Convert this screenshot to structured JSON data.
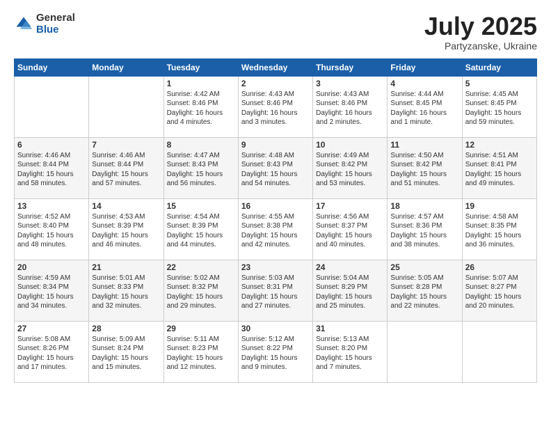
{
  "logo": {
    "general": "General",
    "blue": "Blue"
  },
  "title": "July 2025",
  "location": "Partyzanske, Ukraine",
  "weekdays": [
    "Sunday",
    "Monday",
    "Tuesday",
    "Wednesday",
    "Thursday",
    "Friday",
    "Saturday"
  ],
  "weeks": [
    [
      {
        "day": "",
        "info": ""
      },
      {
        "day": "",
        "info": ""
      },
      {
        "day": "1",
        "info": "Sunrise: 4:42 AM\nSunset: 8:46 PM\nDaylight: 16 hours\nand 4 minutes."
      },
      {
        "day": "2",
        "info": "Sunrise: 4:43 AM\nSunset: 8:46 PM\nDaylight: 16 hours\nand 3 minutes."
      },
      {
        "day": "3",
        "info": "Sunrise: 4:43 AM\nSunset: 8:46 PM\nDaylight: 16 hours\nand 2 minutes."
      },
      {
        "day": "4",
        "info": "Sunrise: 4:44 AM\nSunset: 8:45 PM\nDaylight: 16 hours\nand 1 minute."
      },
      {
        "day": "5",
        "info": "Sunrise: 4:45 AM\nSunset: 8:45 PM\nDaylight: 15 hours\nand 59 minutes."
      }
    ],
    [
      {
        "day": "6",
        "info": "Sunrise: 4:46 AM\nSunset: 8:44 PM\nDaylight: 15 hours\nand 58 minutes."
      },
      {
        "day": "7",
        "info": "Sunrise: 4:46 AM\nSunset: 8:44 PM\nDaylight: 15 hours\nand 57 minutes."
      },
      {
        "day": "8",
        "info": "Sunrise: 4:47 AM\nSunset: 8:43 PM\nDaylight: 15 hours\nand 56 minutes."
      },
      {
        "day": "9",
        "info": "Sunrise: 4:48 AM\nSunset: 8:43 PM\nDaylight: 15 hours\nand 54 minutes."
      },
      {
        "day": "10",
        "info": "Sunrise: 4:49 AM\nSunset: 8:42 PM\nDaylight: 15 hours\nand 53 minutes."
      },
      {
        "day": "11",
        "info": "Sunrise: 4:50 AM\nSunset: 8:42 PM\nDaylight: 15 hours\nand 51 minutes."
      },
      {
        "day": "12",
        "info": "Sunrise: 4:51 AM\nSunset: 8:41 PM\nDaylight: 15 hours\nand 49 minutes."
      }
    ],
    [
      {
        "day": "13",
        "info": "Sunrise: 4:52 AM\nSunset: 8:40 PM\nDaylight: 15 hours\nand 48 minutes."
      },
      {
        "day": "14",
        "info": "Sunrise: 4:53 AM\nSunset: 8:39 PM\nDaylight: 15 hours\nand 46 minutes."
      },
      {
        "day": "15",
        "info": "Sunrise: 4:54 AM\nSunset: 8:39 PM\nDaylight: 15 hours\nand 44 minutes."
      },
      {
        "day": "16",
        "info": "Sunrise: 4:55 AM\nSunset: 8:38 PM\nDaylight: 15 hours\nand 42 minutes."
      },
      {
        "day": "17",
        "info": "Sunrise: 4:56 AM\nSunset: 8:37 PM\nDaylight: 15 hours\nand 40 minutes."
      },
      {
        "day": "18",
        "info": "Sunrise: 4:57 AM\nSunset: 8:36 PM\nDaylight: 15 hours\nand 38 minutes."
      },
      {
        "day": "19",
        "info": "Sunrise: 4:58 AM\nSunset: 8:35 PM\nDaylight: 15 hours\nand 36 minutes."
      }
    ],
    [
      {
        "day": "20",
        "info": "Sunrise: 4:59 AM\nSunset: 8:34 PM\nDaylight: 15 hours\nand 34 minutes."
      },
      {
        "day": "21",
        "info": "Sunrise: 5:01 AM\nSunset: 8:33 PM\nDaylight: 15 hours\nand 32 minutes."
      },
      {
        "day": "22",
        "info": "Sunrise: 5:02 AM\nSunset: 8:32 PM\nDaylight: 15 hours\nand 29 minutes."
      },
      {
        "day": "23",
        "info": "Sunrise: 5:03 AM\nSunset: 8:31 PM\nDaylight: 15 hours\nand 27 minutes."
      },
      {
        "day": "24",
        "info": "Sunrise: 5:04 AM\nSunset: 8:29 PM\nDaylight: 15 hours\nand 25 minutes."
      },
      {
        "day": "25",
        "info": "Sunrise: 5:05 AM\nSunset: 8:28 PM\nDaylight: 15 hours\nand 22 minutes."
      },
      {
        "day": "26",
        "info": "Sunrise: 5:07 AM\nSunset: 8:27 PM\nDaylight: 15 hours\nand 20 minutes."
      }
    ],
    [
      {
        "day": "27",
        "info": "Sunrise: 5:08 AM\nSunset: 8:26 PM\nDaylight: 15 hours\nand 17 minutes."
      },
      {
        "day": "28",
        "info": "Sunrise: 5:09 AM\nSunset: 8:24 PM\nDaylight: 15 hours\nand 15 minutes."
      },
      {
        "day": "29",
        "info": "Sunrise: 5:11 AM\nSunset: 8:23 PM\nDaylight: 15 hours\nand 12 minutes."
      },
      {
        "day": "30",
        "info": "Sunrise: 5:12 AM\nSunset: 8:22 PM\nDaylight: 15 hours\nand 9 minutes."
      },
      {
        "day": "31",
        "info": "Sunrise: 5:13 AM\nSunset: 8:20 PM\nDaylight: 15 hours\nand 7 minutes."
      },
      {
        "day": "",
        "info": ""
      },
      {
        "day": "",
        "info": ""
      }
    ]
  ]
}
